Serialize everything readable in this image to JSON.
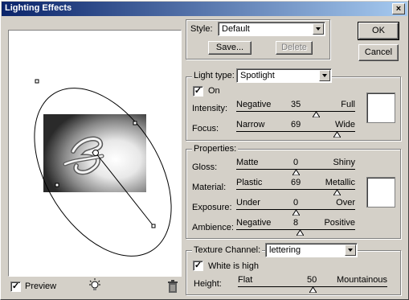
{
  "window": {
    "title": "Lighting Effects",
    "close_label": "×"
  },
  "style": {
    "label": "Style:",
    "value": "Default",
    "save_label": "Save...",
    "delete_label": "Delete"
  },
  "buttons": {
    "ok_label": "OK",
    "cancel_label": "Cancel"
  },
  "light": {
    "type_label": "Light type:",
    "type_value": "Spotlight",
    "on_label": "On",
    "on_checked": true,
    "intensity": {
      "label": "Intensity:",
      "left": "Negative",
      "value": "35",
      "right": "Full",
      "fraction": 0.67
    },
    "focus": {
      "label": "Focus:",
      "left": "Narrow",
      "value": "69",
      "right": "Wide",
      "fraction": 0.85
    },
    "color": "#ffffff"
  },
  "properties": {
    "title": "Properties:",
    "gloss": {
      "label": "Gloss:",
      "left": "Matte",
      "value": "0",
      "right": "Shiny",
      "fraction": 0.5
    },
    "material": {
      "label": "Material:",
      "left": "Plastic",
      "value": "69",
      "right": "Metallic",
      "fraction": 0.85
    },
    "exposure": {
      "label": "Exposure:",
      "left": "Under",
      "value": "0",
      "right": "Over",
      "fraction": 0.5
    },
    "ambience": {
      "label": "Ambience:",
      "left": "Negative",
      "value": "8",
      "right": "Positive",
      "fraction": 0.54
    },
    "color": "#ffffff"
  },
  "texture": {
    "label": "Texture Channel:",
    "value": "lettering",
    "white_is_high_label": "White is high",
    "white_is_high_checked": true,
    "height": {
      "label": "Height:",
      "left": "Flat",
      "value": "50",
      "right": "Mountainous",
      "fraction": 0.5
    }
  },
  "preview": {
    "label": "Preview",
    "checked": true,
    "light_icon": "light-bulb-icon",
    "trash_icon": "trash-icon"
  }
}
